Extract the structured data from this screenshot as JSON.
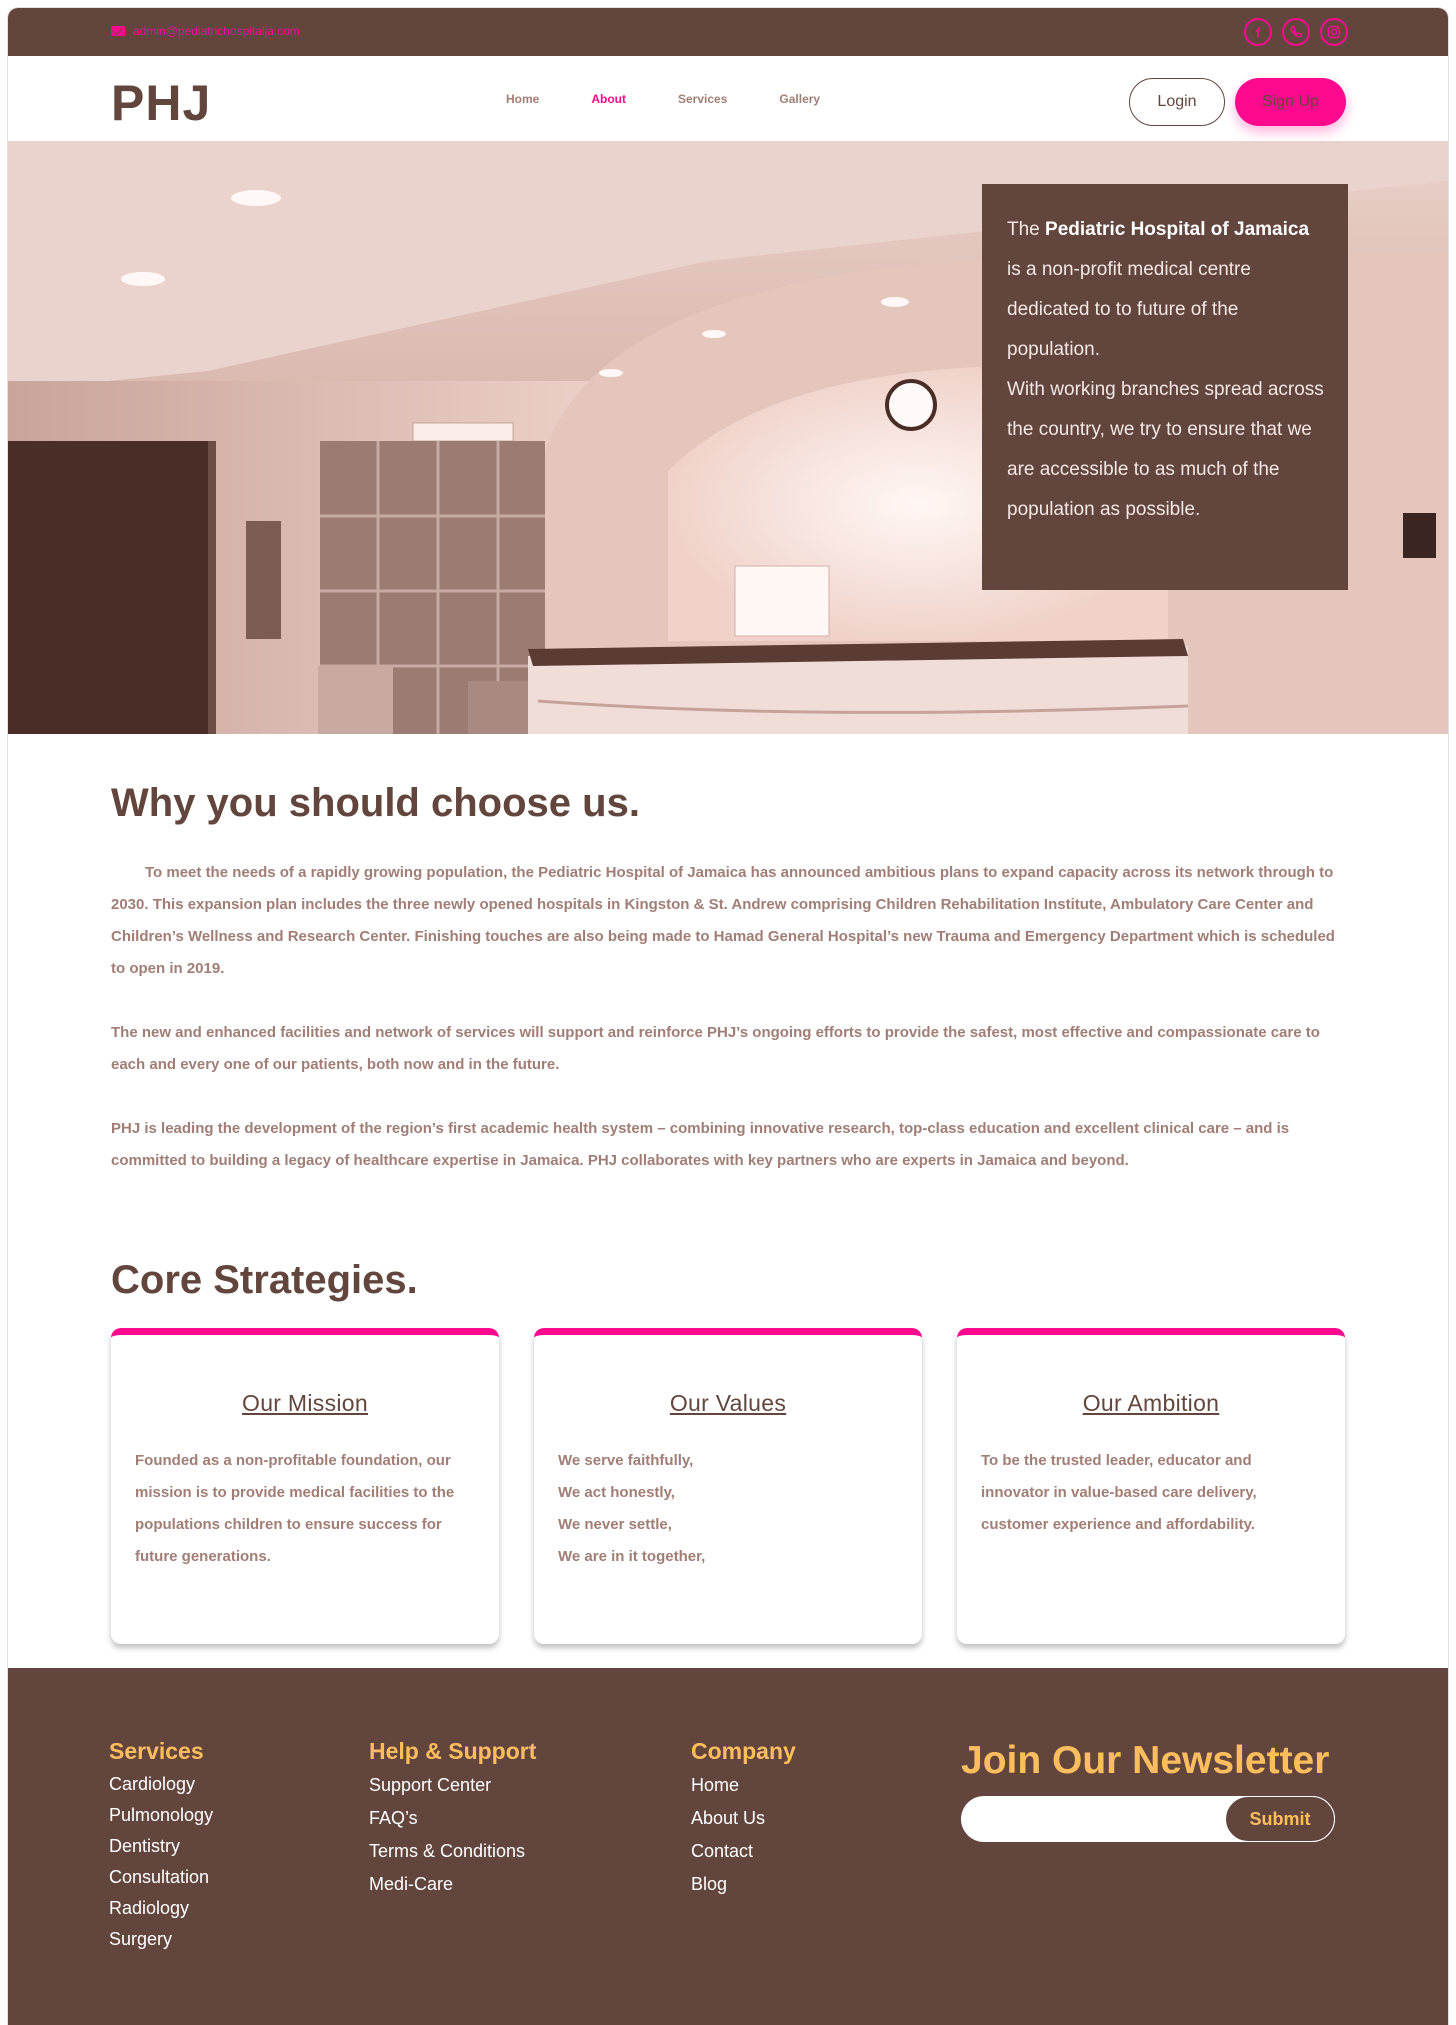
{
  "topbar": {
    "email": "admin@pediatrichospitalja.com",
    "social_icons": [
      "facebook-icon",
      "whatsapp-icon",
      "instagram-icon"
    ]
  },
  "nav": {
    "logo": "PHJ",
    "menu": [
      "Home",
      "About",
      "Services",
      "Gallery"
    ],
    "active": "About",
    "login": "Login",
    "signup": "Sign Up"
  },
  "hero": {
    "text_prefix": "The ",
    "text_bold": "Pediatric Hospital of Jamaica",
    "text_rest": " is a non-profit medical centre dedicated to to future of the population.",
    "text_2": "With  working branches spread across the country, we try to ensure that we are accessible to as much of the population as possible."
  },
  "why": {
    "title": "Why you should choose us.",
    "paragraphs": [
      "To meet the needs of a rapidly growing population, the Pediatric Hospital of Jamaica has announced ambitious plans to expand capacity across its network through to 2030. This expansion plan includes the three newly opened hospitals in Kingston & St. Andrew comprising Children Rehabilitation Institute, Ambulatory Care Center and Children’s Wellness and Research Center. Finishing touches are also being made to Hamad General Hospital’s new Trauma and Emergency Department which is scheduled to open in 2019.",
      "The new and enhanced facilities and network of services will support and reinforce PHJ’s ongoing efforts to provide the safest, most effective and compassionate care to each and every one of our patients, both now and in the future.",
      "PHJ is leading the development of the region’s first academic health system – combining innovative research, top-class education and excellent clinical care – and is committed to building a legacy of healthcare expertise in Jamaica. PHJ collaborates with key partners who are experts in Jamaica and beyond."
    ]
  },
  "core": {
    "title": "Core Strategies.",
    "cards": [
      {
        "title": "Our Mission",
        "body": "Founded as a non-profitable foundation, our mission is to provide medical facilities to the populations children to ensure success for future generations."
      },
      {
        "title": "Our Values",
        "body": "We serve faithfully,\nWe act honestly,\nWe never settle,\nWe are in it together,"
      },
      {
        "title": "Our Ambition",
        "body": "To be the trusted leader, educator and innovator in value-based care delivery, customer experience and affordability."
      }
    ]
  },
  "footer": {
    "services": {
      "title": "Services",
      "items": [
        "Cardiology",
        "Pulmonology",
        "Dentistry",
        "Consultation",
        "Radiology",
        "Surgery"
      ]
    },
    "help": {
      "title": "Help & Support",
      "items": [
        "Support Center",
        "FAQ’s",
        "Terms & Conditions",
        "Medi-Care"
      ]
    },
    "company": {
      "title": "Company",
      "items": [
        "Home",
        "About Us",
        "Contact",
        "Blog"
      ]
    },
    "newsletter": {
      "title": "Join Our Newsletter",
      "input_placeholder": "",
      "submit": "Submit"
    }
  },
  "colors": {
    "brand_brown": "#62463d",
    "accent_pink": "#ff0a8e",
    "footer_heading": "#ffbe5e",
    "body_text": "#a07e76"
  }
}
